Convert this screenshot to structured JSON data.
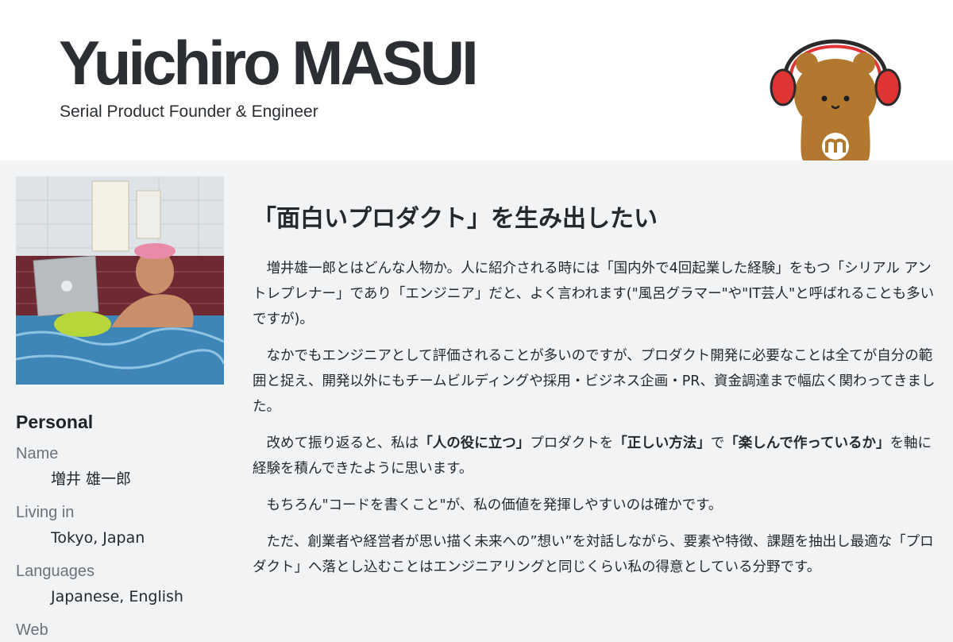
{
  "header": {
    "name": "Yuichiro MASUI",
    "subtitle": "Serial Product Founder & Engineer",
    "mascot_icon": "bear-headphones-mascot"
  },
  "sidebar": {
    "photo_alt": "photo-man-in-bath-with-laptop",
    "personal_heading": "Personal",
    "items": [
      {
        "label": "Name",
        "value": "増井 雄一郎"
      },
      {
        "label": "Living in",
        "value": "Tokyo, Japan"
      },
      {
        "label": "Languages",
        "value": "Japanese, English"
      },
      {
        "label": "Web",
        "value": ""
      }
    ]
  },
  "main": {
    "heading": "「面白いプロダクト」を生み出したい",
    "p1": "増井雄一郎とはどんな人物か。人に紹介される時には「国内外で4回起業した経験」をもつ「シリアル アントレプレナー」であり「エンジニア」だと、よく言われます(\"風呂グラマー\"や\"IT芸人\"と呼ばれることも多いですが)。",
    "p2": "なかでもエンジニアとして評価されることが多いのですが、プロダクト開発に必要なことは全てが自分の範囲と捉え、開発以外にもチームビルディングや採用・ビジネス企画・PR、資金調達まで幅広く関わってきました。",
    "p3": {
      "t1": "改めて振り返ると、私は",
      "b1": "「人の役に立つ」",
      "t2": "プロダクトを",
      "b2": "「正しい方法」",
      "t3": "で",
      "b3": "「楽しんで作っているか」",
      "t4": "を軸に経験を積んできたように思います。"
    },
    "p4": "もちろん\"コードを書くこと\"が、私の価値を発揮しやすいのは確かです。",
    "p5": "ただ、創業者や経営者が思い描く未来への”想い”を対話しながら、要素や特徴、課題を抽出し最適な「プロダクト」へ落とし込むことはエンジニアリングと同じくらい私の得意としている分野です。"
  },
  "colors": {
    "page_bg": "#f2f3f4",
    "header_bg": "#ffffff",
    "text": "#24292e",
    "label": "#6a737d",
    "bear": "#b3782f",
    "headphones": "#e03434"
  }
}
